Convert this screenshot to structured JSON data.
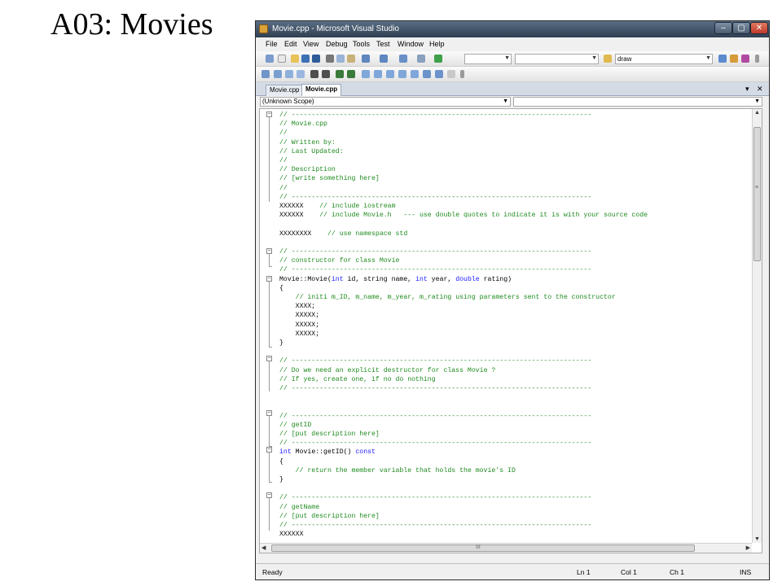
{
  "slide": {
    "title": "A03: Movies"
  },
  "window": {
    "title": "Movie.cpp - Microsoft Visual Studio",
    "buttons": {
      "minimize": "–",
      "maximize": "▢",
      "close": "✕"
    }
  },
  "menu": [
    "File",
    "Edit",
    "View",
    "Debug",
    "Tools",
    "Test",
    "Window",
    "Help"
  ],
  "toolbar": {
    "find_value": "draw"
  },
  "tabs": [
    {
      "label": "Movie.cpp"
    },
    {
      "label": "Movie.cpp"
    }
  ],
  "tab_controls": {
    "dropdown": "▾",
    "close": "✕"
  },
  "navbar": {
    "scope": "(Unknown Scope)",
    "member": ""
  },
  "status": {
    "state": "Ready",
    "line": "Ln 1",
    "col": "Col 1",
    "ch": "Ch 1",
    "mode": "INS"
  },
  "scroll_labels": {
    "hthumb_grip": "III",
    "vthumb_grip": "≡"
  },
  "code": [
    {
      "c": "// ---------------------------------------------------------------------------"
    },
    {
      "c": "// Movie.cpp"
    },
    {
      "c": "//"
    },
    {
      "c": "// Written by:"
    },
    {
      "c": "// Last Updated:"
    },
    {
      "c": "//"
    },
    {
      "c": "// Description"
    },
    {
      "c": "// [write something here]"
    },
    {
      "c": "//"
    },
    {
      "c": "// ---------------------------------------------------------------------------"
    },
    {
      "t": "XXXXXX    ",
      "c": "// include iostream"
    },
    {
      "t": "XXXXXX    ",
      "c": "// include Movie.h   --- use double quotes to indicate it is with your source code"
    },
    {
      "t": ""
    },
    {
      "t": "XXXXXXXX    ",
      "c": "// use namespace std"
    },
    {
      "t": ""
    },
    {
      "c": "// ---------------------------------------------------------------------------"
    },
    {
      "c": "// constructor for class Movie"
    },
    {
      "c": "// ---------------------------------------------------------------------------"
    },
    {
      "t": "Movie::Movie(",
      "k": "int",
      "t2": " id, string name, ",
      "k2": "int",
      "t3": " year, ",
      "k3": "double",
      "t4": " rating)"
    },
    {
      "t": "{"
    },
    {
      "t": "    ",
      "c": "// initi m_ID, m_name, m_year, m_rating using parameters sent to the constructor"
    },
    {
      "t": "    XXXX;"
    },
    {
      "t": "    XXXXX;"
    },
    {
      "t": "    XXXXX;"
    },
    {
      "t": "    XXXXX;"
    },
    {
      "t": "}"
    },
    {
      "t": ""
    },
    {
      "c": "// ---------------------------------------------------------------------------"
    },
    {
      "c": "// Do we need an explicit destructor for class Movie ?"
    },
    {
      "c": "// If yes, create one, if no do nothing"
    },
    {
      "c": "// ---------------------------------------------------------------------------"
    },
    {
      "t": ""
    },
    {
      "t": ""
    },
    {
      "c": "// ---------------------------------------------------------------------------"
    },
    {
      "c": "// getID"
    },
    {
      "c": "// [put description here]"
    },
    {
      "c": "// ---------------------------------------------------------------------------"
    },
    {
      "k": "int",
      "t2": " Movie::getID() ",
      "k2": "const"
    },
    {
      "t": "{"
    },
    {
      "t": "    ",
      "c": "// return the member variable that holds the movie's ID"
    },
    {
      "t": "}"
    },
    {
      "t": ""
    },
    {
      "c": "// ---------------------------------------------------------------------------"
    },
    {
      "c": "// getName"
    },
    {
      "c": "// [put description here]"
    },
    {
      "c": "// ---------------------------------------------------------------------------"
    },
    {
      "t": "XXXXXX"
    }
  ]
}
